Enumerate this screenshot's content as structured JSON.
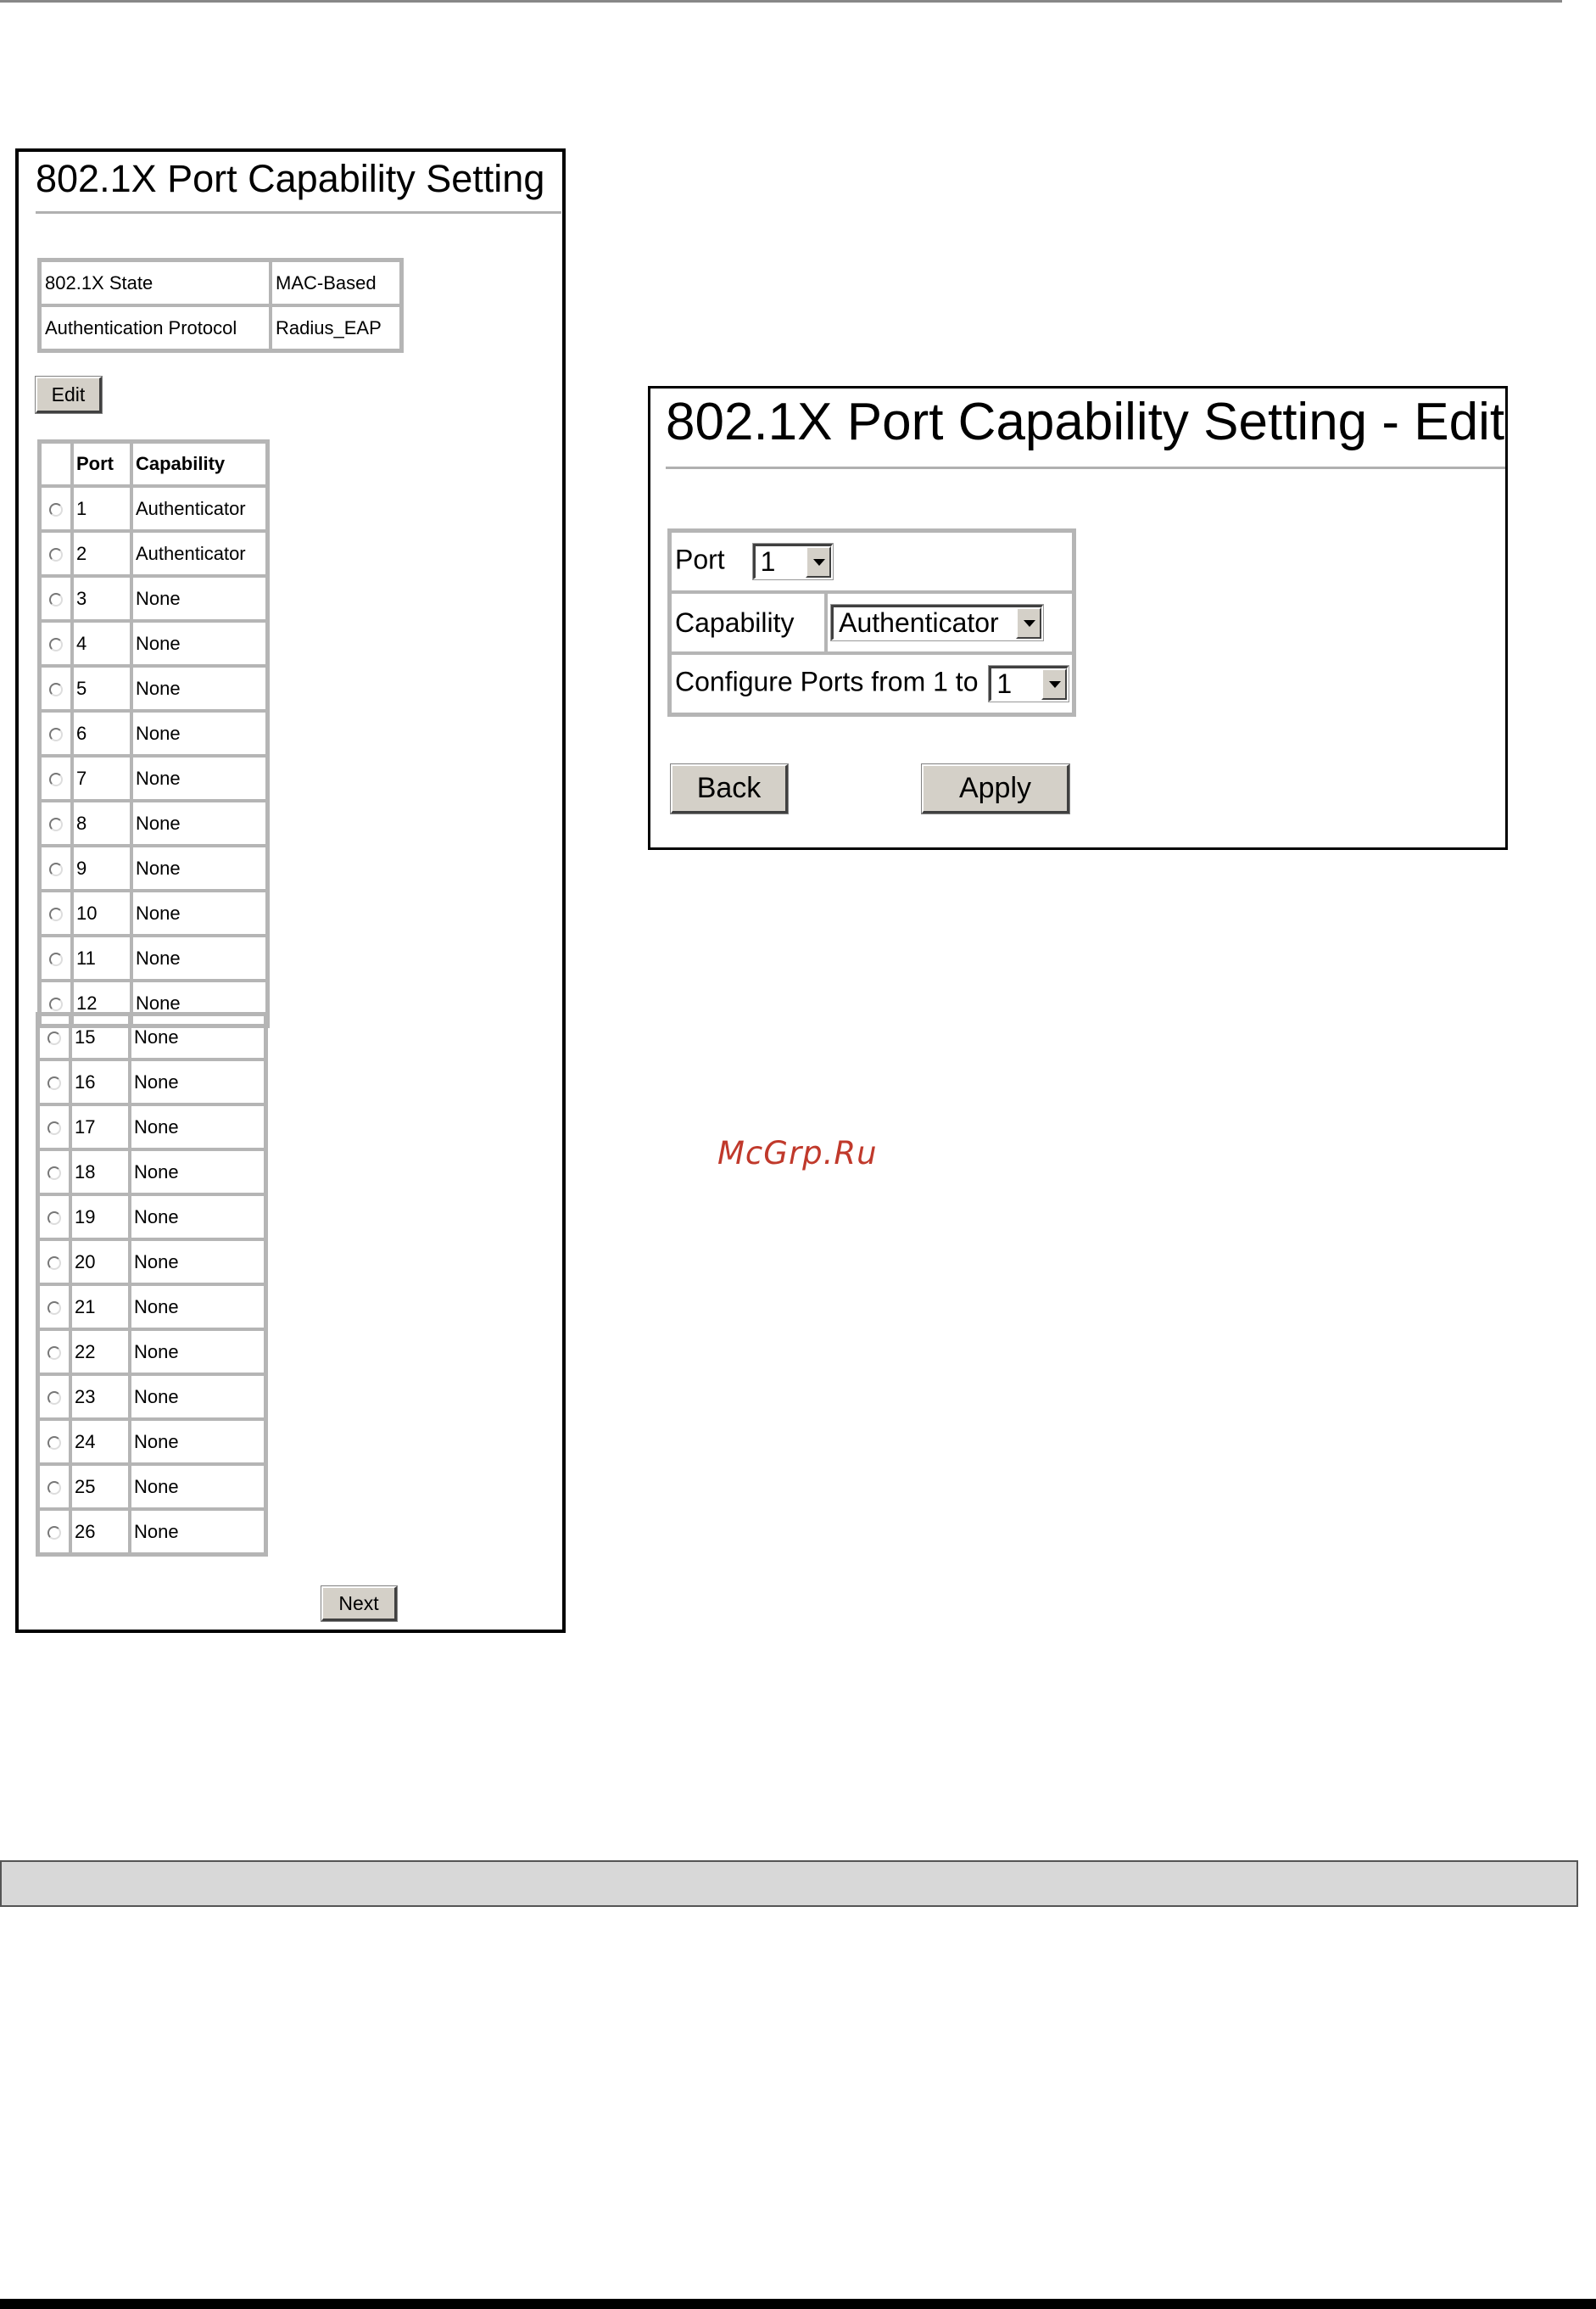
{
  "left_panel": {
    "title": "802.1X Port Capability Setting",
    "info": [
      {
        "label": "802.1X State",
        "value": "MAC-Based"
      },
      {
        "label": "Authentication Protocol",
        "value": "Radius_EAP"
      }
    ],
    "edit_label": "Edit",
    "table_headers": {
      "port": "Port",
      "capability": "Capability"
    },
    "rows_a": [
      {
        "port": "1",
        "capability": "Authenticator"
      },
      {
        "port": "2",
        "capability": "Authenticator"
      },
      {
        "port": "3",
        "capability": "None"
      },
      {
        "port": "4",
        "capability": "None"
      },
      {
        "port": "5",
        "capability": "None"
      },
      {
        "port": "6",
        "capability": "None"
      },
      {
        "port": "7",
        "capability": "None"
      },
      {
        "port": "8",
        "capability": "None"
      },
      {
        "port": "9",
        "capability": "None"
      },
      {
        "port": "10",
        "capability": "None"
      },
      {
        "port": "11",
        "capability": "None"
      },
      {
        "port": "12",
        "capability": "None"
      }
    ],
    "rows_b": [
      {
        "port": "15",
        "capability": "None"
      },
      {
        "port": "16",
        "capability": "None"
      },
      {
        "port": "17",
        "capability": "None"
      },
      {
        "port": "18",
        "capability": "None"
      },
      {
        "port": "19",
        "capability": "None"
      },
      {
        "port": "20",
        "capability": "None"
      },
      {
        "port": "21",
        "capability": "None"
      },
      {
        "port": "22",
        "capability": "None"
      },
      {
        "port": "23",
        "capability": "None"
      },
      {
        "port": "24",
        "capability": "None"
      },
      {
        "port": "25",
        "capability": "None"
      },
      {
        "port": "26",
        "capability": "None"
      }
    ],
    "next_label": "Next"
  },
  "right_panel": {
    "title": "802.1X Port Capability Setting - Edit",
    "port_label": "Port",
    "port_value": "1",
    "capability_label": "Capability",
    "capability_value": "Authenticator",
    "configure_label": "Configure Ports from 1 to",
    "configure_value": "1",
    "back_label": "Back",
    "apply_label": "Apply"
  },
  "watermark": "McGrp.Ru"
}
